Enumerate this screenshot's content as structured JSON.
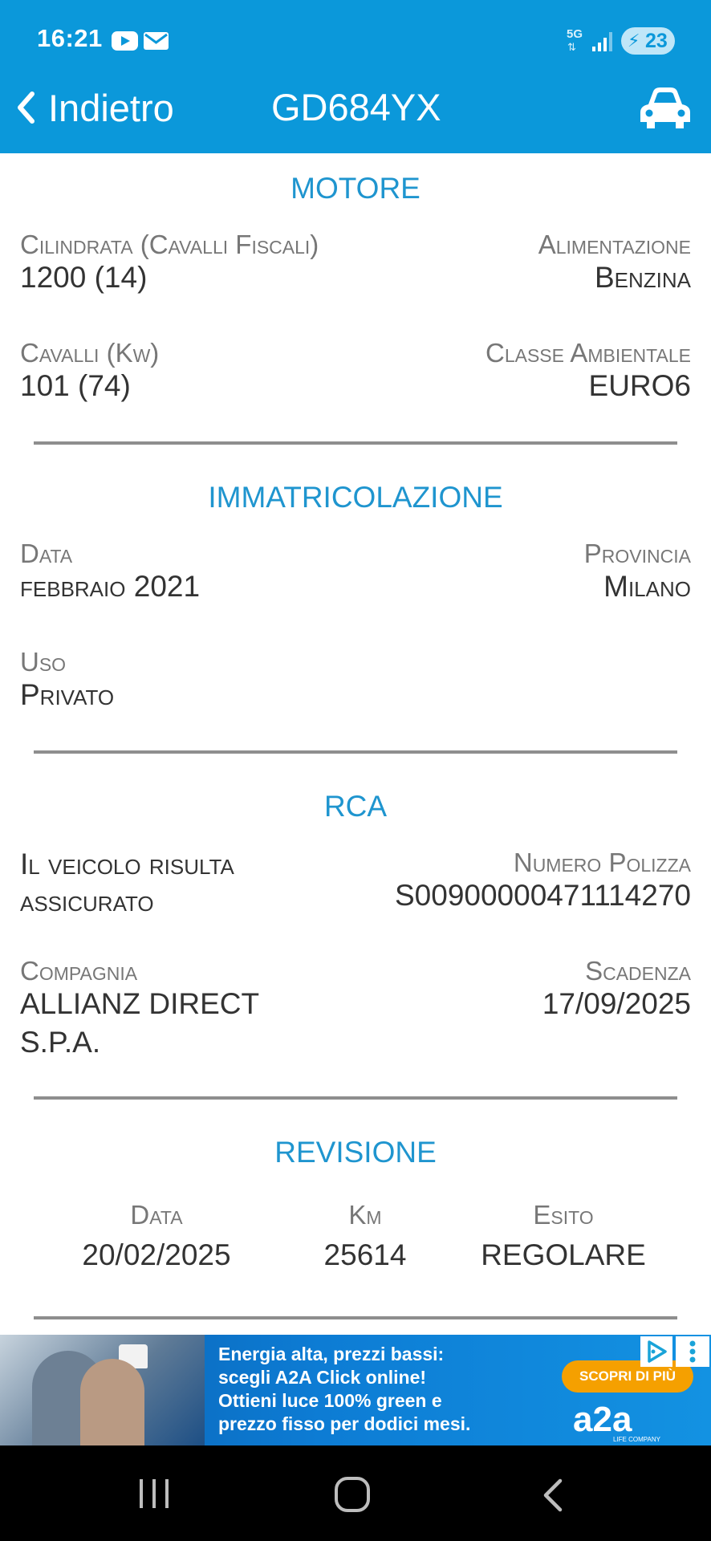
{
  "status_bar": {
    "time": "16:21",
    "network": "5G",
    "battery": "23"
  },
  "nav": {
    "back_label": "Indietro",
    "title": "GD684YX"
  },
  "motore": {
    "title": "MOTORE",
    "cilindrata_label": "Cilindrata (Cavalli Fiscali)",
    "cilindrata_value": "1200 (14)",
    "alimentazione_label": "Alimentazione",
    "alimentazione_value": "Benzina",
    "cavalli_label": "Cavalli (Kw)",
    "cavalli_value": "101 (74)",
    "classe_label": "Classe Ambientale",
    "classe_value": "EURO6"
  },
  "immatricolazione": {
    "title": "IMMATRICOLAZIONE",
    "data_label": "Data",
    "data_value": "febbraio 2021",
    "provincia_label": "Provincia",
    "provincia_value": "Milano",
    "uso_label": "Uso",
    "uso_value": "Privato"
  },
  "rca": {
    "title": "RCA",
    "stato_line1": "Il veicolo risulta",
    "stato_line2": "assicurato",
    "polizza_label": "Numero Polizza",
    "polizza_value": "S009000004711142​70",
    "compagnia_label": "Compagnia",
    "compagnia_line1": "ALLIANZ DIRECT",
    "compagnia_line2": "S.P.A.",
    "scadenza_label": "Scadenza",
    "scadenza_value": "17/09/2025"
  },
  "revisione": {
    "title": "REVISIONE",
    "data_label": "Data",
    "data_value": "20/02/2025",
    "km_label": "Km",
    "km_value": "25614",
    "esito_label": "Esito",
    "esito_value": "REGOLARE"
  },
  "ad": {
    "text": "Energia alta, prezzi bassi:\nscegli A2A Click online!\nOttieni luce 100% green e\nprezzo fisso per dodici mesi.",
    "cta": "SCOPRI DI PIÙ",
    "logo": "a2a",
    "logo_sub": "LIFE COMPANY"
  },
  "colors": {
    "header": "#0b98da",
    "section_title": "#1f95cf",
    "divider": "#8e8e8e"
  }
}
